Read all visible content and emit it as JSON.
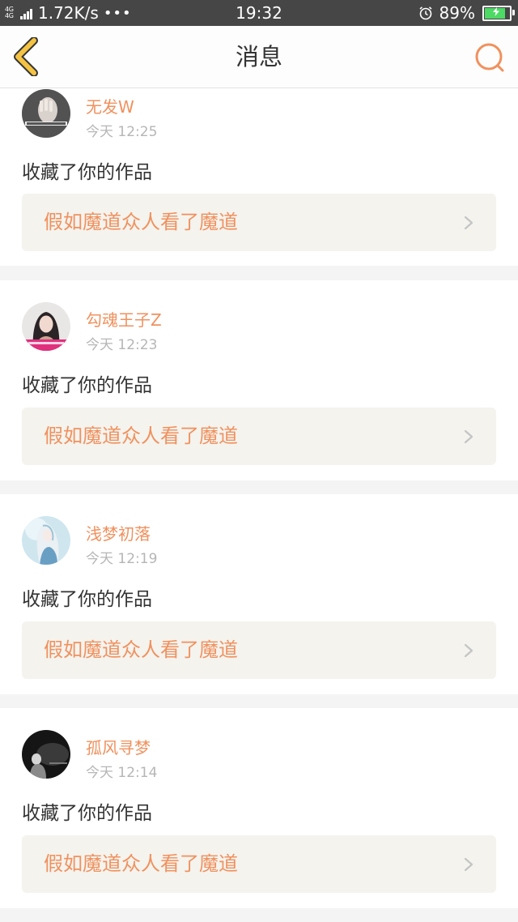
{
  "status_bar": {
    "network": "4G 4G",
    "speed": "1.72K/s",
    "more": "•••",
    "time": "19:32",
    "battery": "89%",
    "battery_level": 0.89,
    "colors": {
      "background": "#464646",
      "battery_fill": "#4cd964"
    }
  },
  "header": {
    "title": "消息",
    "back_icon": "chevron-left-icon",
    "search_icon": "search-icon",
    "colors": {
      "back": "#f5c343",
      "search": "#f0915e"
    }
  },
  "colors": {
    "accent": "#f0915e",
    "time": "#b6b6b6",
    "text": "#333333",
    "work_bg": "#f4f3ee"
  },
  "messages": [
    {
      "username": "无发W",
      "time": "今天 12:25",
      "action": "收藏了你的作品",
      "work_title": "假如魔道众人看了魔道",
      "avatar": "avatar-dark-hand"
    },
    {
      "username": "勾魂王子Z",
      "time": "今天 12:23",
      "action": "收藏了你的作品",
      "work_title": "假如魔道众人看了魔道",
      "avatar": "avatar-portrait-pink"
    },
    {
      "username": "浅梦初落",
      "time": "今天 12:19",
      "action": "收藏了你的作品",
      "work_title": "假如魔道众人看了魔道",
      "avatar": "avatar-anime-blue"
    },
    {
      "username": "孤风寻梦",
      "time": "今天 12:14",
      "action": "收藏了你的作品",
      "work_title": "假如魔道众人看了魔道",
      "avatar": "avatar-dark-figure"
    }
  ]
}
